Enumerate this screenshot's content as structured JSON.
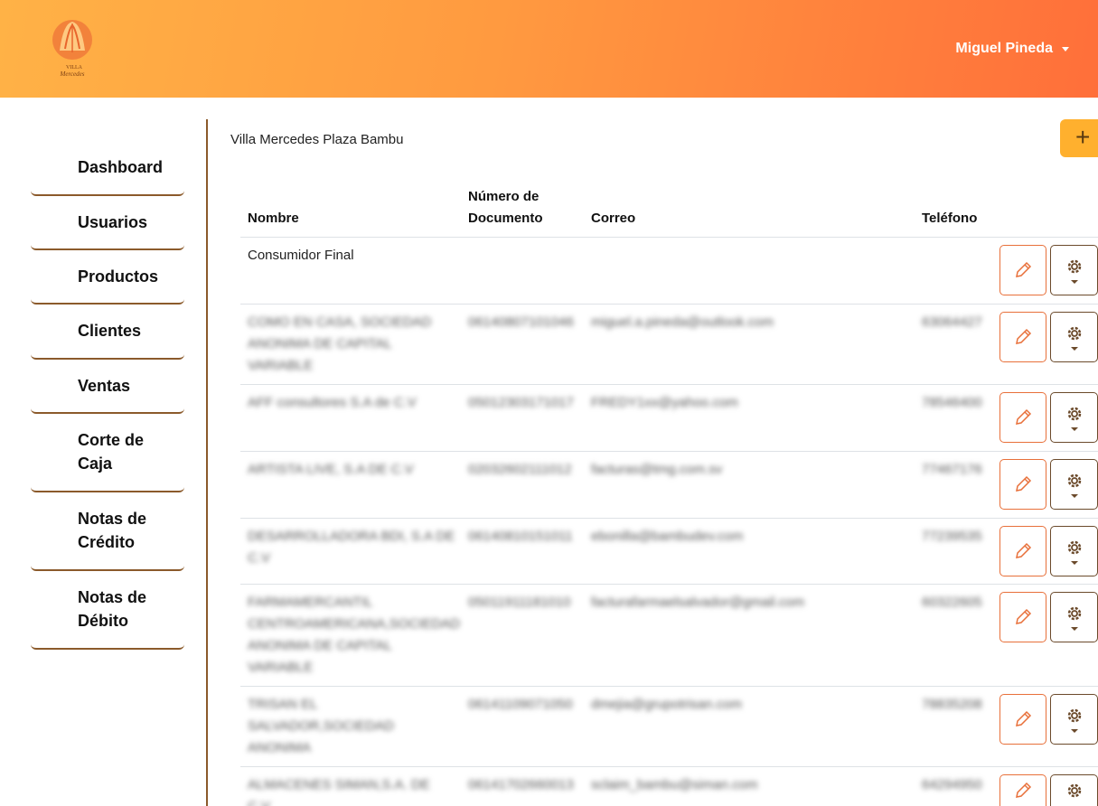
{
  "header": {
    "user_name": "Miguel Pineda",
    "logo_text_line1": "VILLA",
    "logo_text_line2": "Mercedes"
  },
  "sidebar": {
    "items": [
      {
        "label": "Dashboard"
      },
      {
        "label": "Usuarios"
      },
      {
        "label": "Productos"
      },
      {
        "label": "Clientes"
      },
      {
        "label": "Ventas"
      },
      {
        "label": "Corte de Caja"
      },
      {
        "label": "Notas de Crédito"
      },
      {
        "label": "Notas de Débito"
      }
    ]
  },
  "main": {
    "store_name": "Villa Mercedes Plaza Bambu",
    "add_label": "+",
    "columns": {
      "nombre": "Nombre",
      "documento": "Número de Documento",
      "correo": "Correo",
      "telefono": "Teléfono"
    },
    "rows": [
      {
        "nombre": "Consumidor Final",
        "documento": "",
        "correo": "",
        "telefono": ""
      },
      {
        "nombre": "COMO EN CASA, SOCIEDAD ANONIMA DE CAPITAL VARIABLE",
        "documento": "06140807101046",
        "correo": "miguel.a.pineda@outlook.com",
        "telefono": "63064427"
      },
      {
        "nombre": "AFF consultores S.A de C.V",
        "documento": "05012303171017",
        "correo": "FREDY1xx@yahoo.com",
        "telefono": "78546400"
      },
      {
        "nombre": "ARTISTA LIVE, S.A DE C.V",
        "documento": "02032602111012",
        "correo": "facturas@tmg.com.sv",
        "telefono": "77467176"
      },
      {
        "nombre": "DESARROLLADORA BDI, S.A DE C.V",
        "documento": "06140810151011",
        "correo": "ebonilla@bambudev.com",
        "telefono": "77239535"
      },
      {
        "nombre": "FARMAMERCANTIL CENTROAMERICANA,SOCIEDAD ANONIMA DE CAPITAL VARIABLE",
        "documento": "05011911181010",
        "correo": "facturafarmaelsalvador@gmail.com",
        "telefono": "60322605"
      },
      {
        "nombre": "TRISAN EL SALVADOR,SOCIEDAD ANONIMA",
        "documento": "06141109071050",
        "correo": "dmejia@grupotrisan.com",
        "telefono": "78835208"
      },
      {
        "nombre": "ALMACENES SIMAN,S.A. DE C.V",
        "documento": "06141702660013",
        "correo": "sclaim_bambu@siman.com",
        "telefono": "64294950"
      }
    ]
  },
  "colors": {
    "header_start": "#ffb246",
    "header_end": "#ff6f3a",
    "accent_brown": "#8b5a2b",
    "edit_orange": "#e8703a",
    "add_button": "#ffb02e"
  },
  "icons": {
    "edit": "pencil-icon",
    "settings": "gear-icon",
    "add": "plus-icon",
    "dropdown": "caret-down-icon"
  }
}
